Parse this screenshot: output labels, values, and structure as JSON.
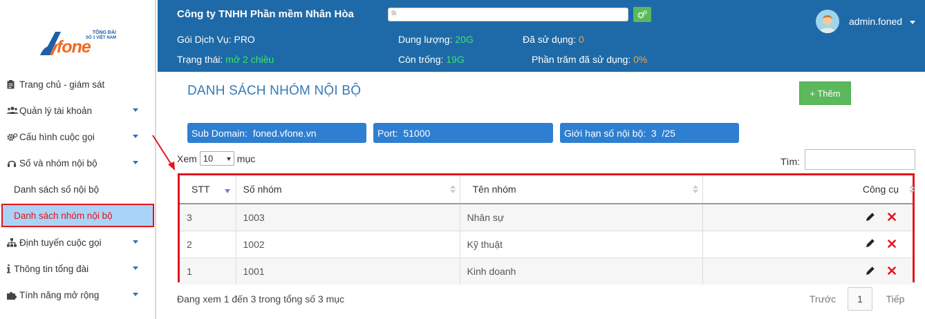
{
  "header": {
    "company": "Công ty TNHH Phần mềm Nhân Hòa",
    "search_placeholder": "tk",
    "service_label": "Gói Dịch Vụ:",
    "service_value": "PRO",
    "status_label": "Trạng thái:",
    "status_value": "mở 2 chiều",
    "capacity_label": "Dung lượng:",
    "capacity_value": "20G",
    "free_label": "Còn trống:",
    "free_value": "19G",
    "used_label": "Đã sử dụng:",
    "used_value": "0",
    "percent_label": "Phần trăm đã sử dụng:",
    "percent_value": "0%",
    "username": "admin.foned"
  },
  "logo": {
    "tagline1": "TỔNG ĐÀI",
    "tagline2": "SỐ 1 VIỆT NAM",
    "word": "fone"
  },
  "sidebar": {
    "items": [
      {
        "label": "Trang chủ - giám sát",
        "icon": "clipboard-icon"
      },
      {
        "label": "Quản lý tài khoản",
        "icon": "users-icon"
      },
      {
        "label": "Cấu hình cuộc gọi",
        "icon": "cogs-icon"
      },
      {
        "label": "Số và nhóm nội bộ",
        "icon": "headset-icon"
      },
      {
        "label": "Danh sách số nội bộ"
      },
      {
        "label": "Danh sách nhóm nội bộ"
      },
      {
        "label": "Định tuyến cuộc gọi",
        "icon": "sitemap-icon"
      },
      {
        "label": "Thông tin tổng đài",
        "icon": "info-icon"
      },
      {
        "label": "Tính năng mở rộng",
        "icon": "puzzle-icon"
      }
    ]
  },
  "main": {
    "title": "DANH SÁCH NHÓM NỘI BỘ",
    "add_button": "+ Thêm",
    "subdomain": "Sub Domain:  foned.vfone.vn",
    "port": "Port:  51000",
    "limit": "Giới hạn số nội bộ:  3  /25",
    "show_label": "Xem",
    "show_value": "10",
    "entries_label": "mục",
    "search_label": "Tìm:",
    "table": {
      "headers": [
        "STT",
        "Số nhóm",
        "Tên nhóm",
        "Công cụ"
      ],
      "rows": [
        [
          "3",
          "1003",
          "Nhân sự"
        ],
        [
          "2",
          "1002",
          "Kỹ thuật"
        ],
        [
          "1",
          "1001",
          "Kinh doanh"
        ]
      ]
    },
    "paging_info": "Đang xem 1 đến 3 trong tổng số 3 mục",
    "prev": "Trước",
    "page": "1",
    "next": "Tiếp"
  },
  "colors": {
    "header_bg": "#1e6aa8",
    "accent_blue": "#2e7fd1",
    "highlight_red": "#e3141b",
    "success_green": "#5cb85c"
  }
}
